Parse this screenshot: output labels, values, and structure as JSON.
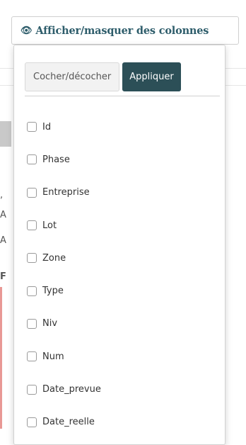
{
  "toggle_button": {
    "icon": "eye-icon",
    "label": "Afficher/masquer des colonnes"
  },
  "dropdown": {
    "toggle_all_label": "Cocher/décocher",
    "apply_label": "Appliquer",
    "columns": [
      {
        "label": "Id",
        "checked": false
      },
      {
        "label": "Phase",
        "checked": false
      },
      {
        "label": "Entreprise",
        "checked": false
      },
      {
        "label": "Lot",
        "checked": false
      },
      {
        "label": "Zone",
        "checked": false
      },
      {
        "label": "Type",
        "checked": false
      },
      {
        "label": "Niv",
        "checked": false
      },
      {
        "label": "Num",
        "checked": false
      },
      {
        "label": "Date_prevue",
        "checked": false
      },
      {
        "label": "Date_reelle",
        "checked": false
      }
    ]
  },
  "background_glyphs": [
    ",",
    "A",
    "A",
    "F"
  ],
  "colors": {
    "accent": "#2c4f57",
    "title": "#2e5d6b"
  }
}
